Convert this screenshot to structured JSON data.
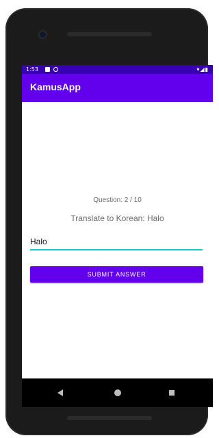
{
  "status_bar": {
    "time": "1:53",
    "right_icons": "▾◢▮"
  },
  "app_bar": {
    "title": "KamusApp"
  },
  "quiz": {
    "question_label": "Question: 2 / 10",
    "prompt": "Translate to Korean: Halo",
    "answer_value": "Halo",
    "submit_label": "SUBMIT ANSWER"
  },
  "colors": {
    "primary": "#6200ee",
    "primary_dark": "#3700b3",
    "accent": "#03dac5"
  },
  "icons": {
    "status_left": [
      "sd-card-icon",
      "sync-icon"
    ],
    "status_right": [
      "wifi-icon",
      "signal-icon",
      "battery-icon"
    ],
    "nav": [
      "back-icon",
      "home-icon",
      "recents-icon"
    ]
  }
}
